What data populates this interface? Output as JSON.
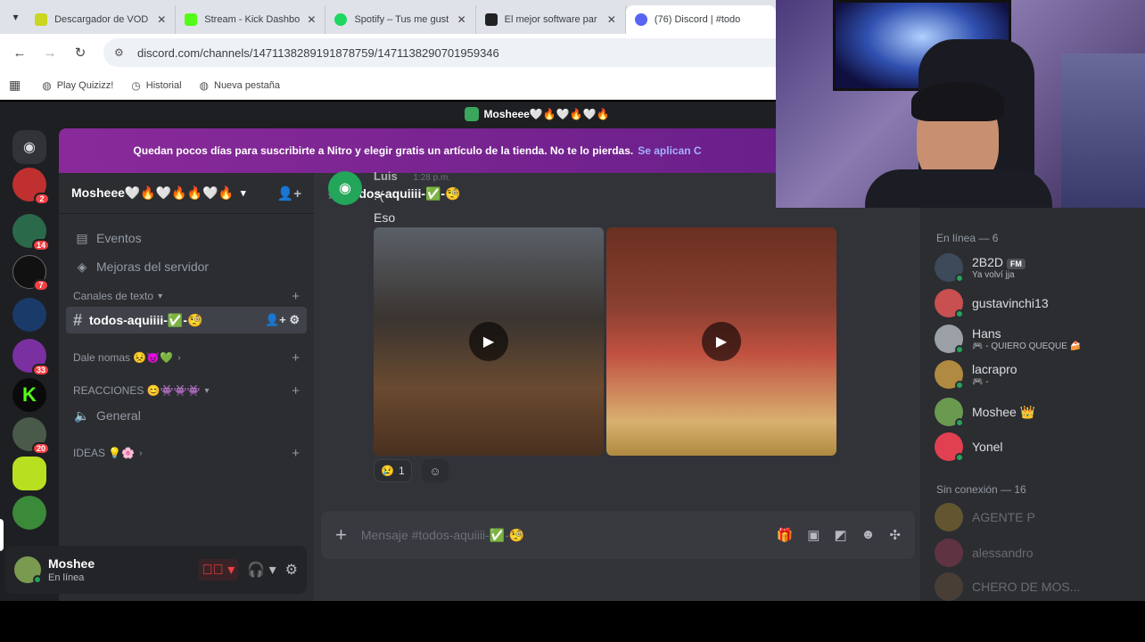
{
  "browser": {
    "tabs": [
      {
        "title": "Descargador de VOD",
        "favicon_color": "#c9d71f"
      },
      {
        "title": "Stream - Kick Dashbo",
        "favicon_color": "#53fc18"
      },
      {
        "title": "Spotify – Tus me gust",
        "favicon_color": "#1ed760"
      },
      {
        "title": "El mejor software par",
        "favicon_color": "#222222"
      },
      {
        "title": "(76) Discord | #todo",
        "favicon_color": "#5865f2"
      }
    ],
    "url": "discord.com/channels/1471138289191878759/1471138290701959346",
    "bookmarks": [
      "Play Quizizz!",
      "Historial",
      "Nueva pestaña"
    ]
  },
  "discord": {
    "window_title": "Mosheee🤍🔥🤍🔥🤍🔥",
    "nitro_banner": "Quedan pocos días para suscribirte a Nitro y elegir gratis un artículo de la tienda. No te lo pierdas.",
    "nitro_link": "Se aplican C",
    "guild_badges": [
      "2",
      "14",
      "7",
      "33",
      "20"
    ],
    "server_name": "Mosheee🤍🔥🤍🔥🔥🤍🔥",
    "sidebar": {
      "events": "Eventos",
      "boosts": "Mejoras del servidor",
      "text_category": "Canales de texto",
      "active_channel": "todos-aquiiii-✅-🧐",
      "category_dale": "Dale nomas 😣😈💚",
      "category_reacciones": "REACCIONES 😊👾👾👾",
      "voice_general": "General",
      "category_ideas": "IDEAS 💡🌸"
    },
    "user": {
      "name": "Moshee",
      "status": "En línea"
    },
    "channel_header": "todos-aquiiii-✅-🧐",
    "messages": {
      "author": "Luis",
      "time": "1:28 p.m.",
      "line1": ":'(",
      "line2": "Eso"
    },
    "reaction": {
      "emoji": "😢",
      "count": "1"
    },
    "composer_placeholder": "Mensaje #todos-aquiiii-✅-🧐",
    "members": {
      "online_header": "En línea — 6",
      "online": [
        {
          "name": "2B2D",
          "sub": "Ya volví jja",
          "tag": "FM",
          "color": "#3d4a5a"
        },
        {
          "name": "gustavinchi13",
          "sub": "",
          "color": "#c85050"
        },
        {
          "name": "Hans",
          "sub": "🎮 - QUIERO QUEQUE 🍰",
          "color": "#9aa0a6"
        },
        {
          "name": "lacrapro",
          "sub": "🎮 -",
          "color": "#b08a40"
        },
        {
          "name": "Moshee 👑",
          "sub": "",
          "color": "#6a9a50"
        },
        {
          "name": "Yonel",
          "sub": "",
          "color": "#e04050"
        }
      ],
      "offline_header": "Sin conexión — 16",
      "offline": [
        {
          "name": "AGENTE P",
          "color": "#c8a030"
        },
        {
          "name": "alessandro",
          "color": "#c04060"
        },
        {
          "name": "CHERO DE MOS...",
          "color": "#806040"
        }
      ]
    }
  }
}
